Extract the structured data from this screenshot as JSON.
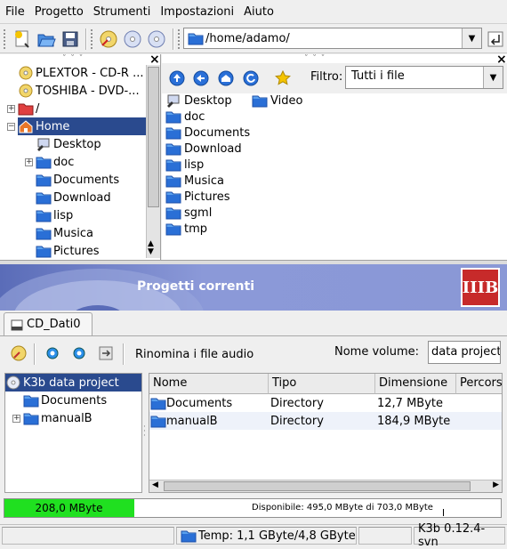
{
  "menubar": {
    "items": [
      "File",
      "Progetto",
      "Strumenti",
      "Impostazioni",
      "Aiuto"
    ]
  },
  "toolbar": {
    "buttons": [
      "new-project-icon",
      "open-icon",
      "save-icon",
      "cd-burn-icon",
      "cd-copy-icon",
      "cd-blank-icon"
    ],
    "path": "/home/adamo/"
  },
  "devices_tree": {
    "items": [
      {
        "label": "PLEXTOR - CD-R ...",
        "icon": "cd-drive-icon"
      },
      {
        "label": "TOSHIBA - DVD-...",
        "icon": "dvd-drive-icon"
      },
      {
        "label": "/",
        "icon": "root-folder-icon"
      },
      {
        "label": "Home",
        "icon": "home-icon",
        "selected": true
      },
      {
        "label": "Desktop",
        "icon": "desktop-icon"
      },
      {
        "label": "doc",
        "icon": "folder-icon"
      },
      {
        "label": "Documents",
        "icon": "folder-icon"
      },
      {
        "label": "Download",
        "icon": "folder-icon"
      },
      {
        "label": "lisp",
        "icon": "folder-icon"
      },
      {
        "label": "Musica",
        "icon": "folder-icon"
      },
      {
        "label": "Pictures",
        "icon": "folder-icon"
      }
    ]
  },
  "file_browser": {
    "filter_label": "Filtro:",
    "filter_value": "Tutti i file",
    "items": [
      "Desktop",
      "Video",
      "doc",
      "Documents",
      "Download",
      "lisp",
      "Musica",
      "Pictures",
      "sgml",
      "tmp"
    ]
  },
  "k3b": {
    "header_title": "Progetti correnti",
    "logo_text": "IIIB",
    "tab_label": "CD_Dati0",
    "rename_label": "Rinomina i file audio",
    "volume_label": "Nome volume:",
    "volume_value": "data project",
    "project_tree": [
      "K3b data project",
      "Documents",
      "manualB"
    ],
    "columns": [
      "Nome",
      "Tipo",
      "Dimensione",
      "Percors"
    ],
    "rows": [
      {
        "name": "Documents",
        "type": "Directory",
        "size": "12,7 MByte"
      },
      {
        "name": "manualB",
        "type": "Directory",
        "size": "184,9 MByte"
      }
    ]
  },
  "capacity": {
    "used_text": "208,0 MByte",
    "available_text": "Disponibile: 495,0 MByte di 703,0 MByte",
    "used_fraction": 0.296
  },
  "statusbar": {
    "temp": "Temp: 1,1 GByte/4,8 GByte",
    "version": "K3b 0.12.4-svn"
  },
  "colors": {
    "selection": "#2a4a8e",
    "folder_blue": "#2a6fd6",
    "capacity_fill": "#20e020",
    "header_blue": "#5a6cb8"
  }
}
